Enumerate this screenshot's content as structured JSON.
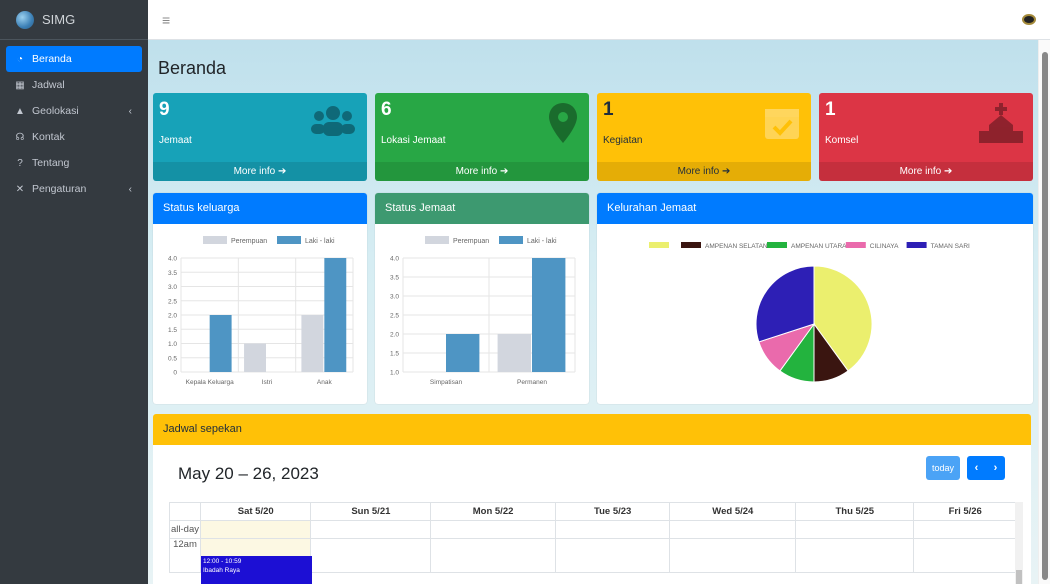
{
  "app": {
    "brand": "SIMG"
  },
  "sidebar": {
    "items": [
      {
        "label": "Beranda",
        "icon": "tachometer-icon",
        "active": true
      },
      {
        "label": "Jadwal",
        "icon": "calendar-icon"
      },
      {
        "label": "Geolokasi",
        "icon": "map-icon",
        "has_arrow": true
      },
      {
        "label": "Kontak",
        "icon": "headset-icon"
      },
      {
        "label": "Tentang",
        "icon": "question-icon"
      },
      {
        "label": "Pengaturan",
        "icon": "tools-icon",
        "has_arrow": true
      }
    ]
  },
  "header": {
    "menu_icon": "hamburger-icon",
    "user_icon": "user-avatar-icon"
  },
  "page": {
    "title": "Beranda"
  },
  "boxes": [
    {
      "value": "9",
      "label": "Jemaat",
      "footer": "More info",
      "color": "#17a2b8",
      "icon": "users-icon"
    },
    {
      "value": "6",
      "label": "Lokasi Jemaat",
      "footer": "More info",
      "color": "#28a745",
      "icon": "map-marker-icon"
    },
    {
      "value": "1",
      "label": "Kegiatan",
      "footer": "More info",
      "color": "#ffc107",
      "icon": "calendar-check-icon"
    },
    {
      "value": "1",
      "label": "Komsel",
      "footer": "More info",
      "color": "#dc3545",
      "icon": "church-icon"
    }
  ],
  "cards": {
    "status_keluarga": {
      "title": "Status keluarga"
    },
    "status_jemaat": {
      "title": "Status Jemaat"
    },
    "kelurahan": {
      "title": "Kelurahan Jemaat"
    }
  },
  "chart_data": [
    {
      "type": "bar",
      "title": "Status keluarga",
      "categories": [
        "Kepala Keluarga",
        "Istri",
        "Anak"
      ],
      "series": [
        {
          "name": "Perempuan",
          "values": [
            0,
            1,
            2
          ],
          "color": "#d2d6de"
        },
        {
          "name": "Laki - laki",
          "values": [
            2,
            0,
            4
          ],
          "color": "#4e95c4"
        }
      ],
      "ylim": [
        0,
        4
      ],
      "yticks": [
        "0",
        "0.5",
        "1.0",
        "1.5",
        "2.0",
        "2.5",
        "3.0",
        "3.5",
        "4.0"
      ],
      "legend": "top"
    },
    {
      "type": "bar",
      "title": "Status Jemaat",
      "categories": [
        "Simpatisan",
        "Permanen"
      ],
      "series": [
        {
          "name": "Perempuan",
          "values": [
            0,
            2
          ],
          "color": "#d2d6de"
        },
        {
          "name": "Laki - laki",
          "values": [
            2,
            4
          ],
          "color": "#4e95c4"
        }
      ],
      "ylim": [
        1,
        4
      ],
      "yticks": [
        "1.0",
        "1.5",
        "2.0",
        "2.5",
        "3.0",
        "3.5",
        "4.0"
      ],
      "legend": "top"
    },
    {
      "type": "pie",
      "title": "Kelurahan Jemaat",
      "labels": [
        "",
        "AMPENAN SELATAN",
        "AMPENAN UTARA",
        "CILINAYA",
        "TAMAN SARI"
      ],
      "values": [
        4,
        1,
        1,
        1,
        3
      ],
      "colors": [
        "#ebef6e",
        "#3a1510",
        "#23b33e",
        "#ea6aac",
        "#2d1fb5"
      ],
      "legend": "top"
    }
  ],
  "calendar": {
    "card_title": "Jadwal sepekan",
    "range": "May 20 – 26, 2023",
    "today_label": "today",
    "prev": "‹",
    "next": "›",
    "days": [
      "Sat 5/20",
      "Sun 5/21",
      "Mon 5/22",
      "Tue 5/23",
      "Wed 5/24",
      "Thu 5/25",
      "Fri 5/26"
    ],
    "allday_label": "all-day",
    "time_label": "12am",
    "event": {
      "time": "12:00 - 10:59",
      "title": "Ibadah Raya",
      "color": "#1c0fd4"
    }
  }
}
